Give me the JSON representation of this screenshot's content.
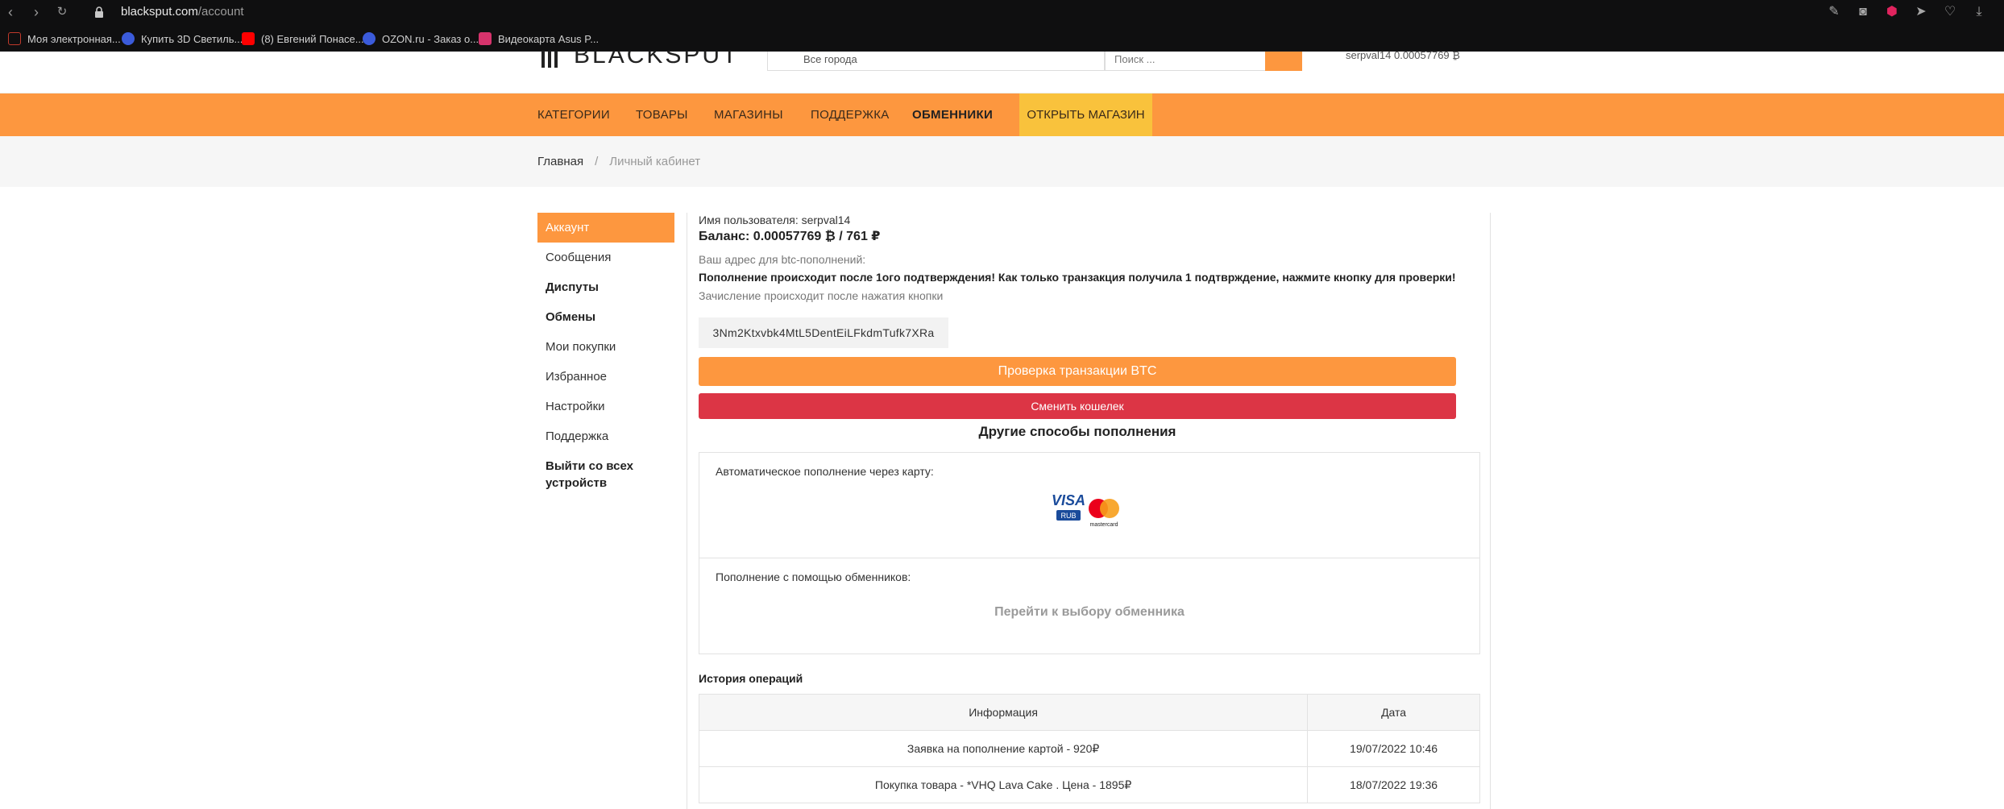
{
  "browser": {
    "url_domain": "blacksput.com",
    "url_path": "/account",
    "bookmarks": [
      {
        "label": "Моя электронная...",
        "color": "#c0392b"
      },
      {
        "label": "Купить 3D Светиль...",
        "color": "#3b5bdb"
      },
      {
        "label": "(8) Евгений Понасе...",
        "color": "#ff0000"
      },
      {
        "label": "OZON.ru - Заказ о...",
        "color": "#3b5bdb"
      },
      {
        "label": "Видеокарта Asus P...",
        "color": "#d6336c"
      }
    ]
  },
  "header": {
    "logo_text": "BLACKSPUT",
    "city_select": "Все города",
    "search_placeholder": "Поиск ...",
    "balance_text": "serpval14 0.00057769 ₿"
  },
  "nav": {
    "items": [
      "КАТЕГОРИИ",
      "ТОВАРЫ",
      "МАГАЗИНЫ",
      "ПОДДЕРЖКА",
      "ОБМЕННИКИ"
    ],
    "open_shop": "ОТКРЫТЬ МАГАЗИН"
  },
  "breadcrumb": {
    "home": "Главная",
    "separator": "/",
    "current": "Личный кабинет"
  },
  "sidebar": {
    "items": [
      "Аккаунт",
      "Сообщения",
      "Диспуты",
      "Обмены",
      "Мои покупки",
      "Избранное",
      "Настройки",
      "Поддержка",
      "Выйти со всех устройств"
    ]
  },
  "account": {
    "username": "Имя пользователя: serpval14",
    "balance": "Баланс: 0.00057769 ₿ / 761 ₽",
    "address_label": "Ваш адрес для btc-пополнений:",
    "notice": "Пополнение происходит после 1ого подтверждения! Как только транзакция получила 1 подтврждение, нажмите кнопку для проверки!",
    "credit_note": "Зачисление происходит после нажатия кнопки",
    "wallet_address": "3Nm2Ktxvbk4MtL5DentEiLFkdmTufk7XRa",
    "check_button": "Проверка транзакции BTC",
    "change_button": "Сменить кошелек",
    "other_methods_title": "Другие способы пополнения",
    "card_topup_label": "Автоматическое пополнение через карту:",
    "visa_text": "VISA",
    "visa_sub": "RUB",
    "mastercard_text": "mastercard",
    "exchanger_label": "Пополнение с помощью обменников:",
    "exchanger_link": "Перейти к выбору обменника"
  },
  "history": {
    "title": "История операций",
    "headers": [
      "Информация",
      "Дата"
    ],
    "rows": [
      {
        "info": "Заявка на пополнение картой - 920₽",
        "date": "19/07/2022 10:46"
      },
      {
        "info": "Покупка товара - *VHQ Lava Cake . Цена - 1895₽",
        "date": "18/07/2022 19:36"
      }
    ]
  },
  "colors": {
    "accent": "#fd973f",
    "open_shop": "#f9c23c",
    "danger": "#dc3545"
  }
}
